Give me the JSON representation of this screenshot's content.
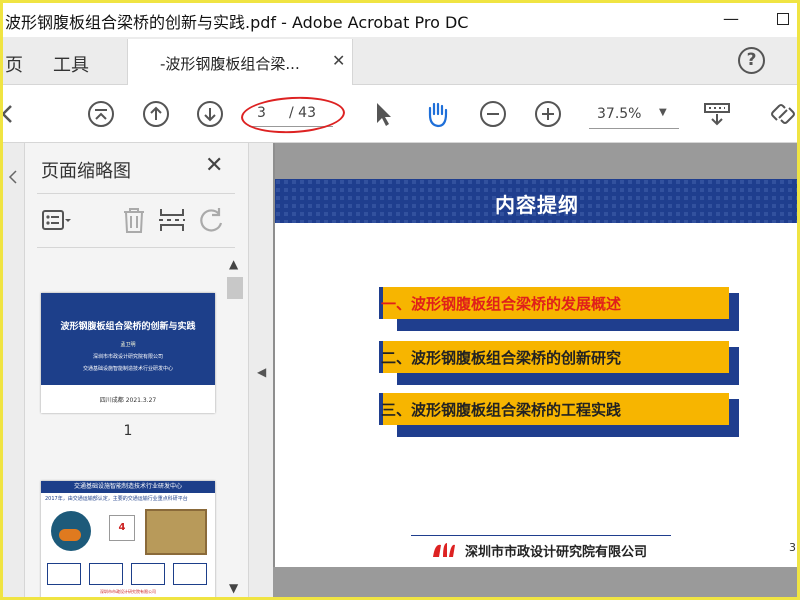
{
  "window": {
    "title": "波形钢腹板组合梁桥的创新与实践.pdf - Adobe Acrobat Pro DC",
    "minimize_icon": "minimize-icon",
    "maximize_icon": "maximize-icon"
  },
  "tabs": {
    "items": [
      "页",
      "工具"
    ],
    "document_tab": "-波形钢腹板组合梁...",
    "help_label": "?"
  },
  "toolbar": {
    "current_page": "3",
    "total_pages": "/ 43",
    "zoom": "37.5%",
    "icons": [
      "first-page-icon",
      "prev-page-icon",
      "next-page-icon",
      "select-cursor-icon",
      "hand-tool-icon",
      "zoom-out-icon",
      "zoom-in-icon",
      "scroll-mode-icon",
      "link-icon"
    ]
  },
  "thumbnail_panel": {
    "title": "页面缩略图",
    "close": "✕",
    "page1": {
      "title": "波形钢腹板组合梁桥的创新与实践",
      "author": "孟卫明",
      "org": "深圳市市政设计研究院有限公司",
      "center": "交通基础设施智能制造技术行业研发中心",
      "place": "四川成都",
      "date": "2021.3.27",
      "number": "1"
    },
    "page2": {
      "header": "交通基础设施智能制造技术行业研发中心",
      "subtitle": "2017年，由交通运输部认定，主要的交通运输行业重点科研平台",
      "badge": "4",
      "footer": "深圳市市政设计研究院有限公司"
    }
  },
  "slide": {
    "heading": "内容提纲",
    "items": [
      "一、波形钢腹板组合梁桥的发展概述",
      "二、波形钢腹板组合梁桥的创新研究",
      "三、波形钢腹板组合梁桥的工程实践"
    ],
    "organization": "深圳市市政设计研究院有限公司",
    "page_number": "3"
  },
  "colors": {
    "accent_blue": "#1f3e8e",
    "item_gold": "#f7b500",
    "highlight_red": "#e0201a",
    "annotation_red": "#d22222"
  }
}
